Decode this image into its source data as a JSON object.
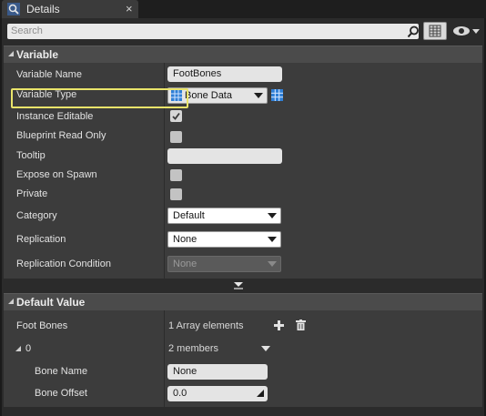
{
  "tab": {
    "label": "Details",
    "close": "×"
  },
  "search": {
    "placeholder": "Search"
  },
  "sections": {
    "variable": "Variable",
    "default_value": "Default Value"
  },
  "variable": {
    "name": {
      "label": "Variable Name",
      "value": "FootBones"
    },
    "type": {
      "label": "Variable Type",
      "value": "Bone Data"
    },
    "instance_editable": {
      "label": "Instance Editable",
      "checked": true
    },
    "blueprint_read_only": {
      "label": "Blueprint Read Only",
      "checked": false
    },
    "tooltip": {
      "label": "Tooltip",
      "value": ""
    },
    "expose_on_spawn": {
      "label": "Expose on Spawn",
      "checked": false
    },
    "private": {
      "label": "Private",
      "checked": false
    },
    "category": {
      "label": "Category",
      "value": "Default"
    },
    "replication": {
      "label": "Replication",
      "value": "None"
    },
    "replication_condition": {
      "label": "Replication Condition",
      "value": "None"
    }
  },
  "default_value": {
    "foot_bones": {
      "label": "Foot Bones",
      "value": "1 Array elements"
    },
    "element0": {
      "label": "0",
      "value": "2 members"
    },
    "bone_name": {
      "label": "Bone Name",
      "value": "None"
    },
    "bone_offset": {
      "label": "Bone Offset",
      "value": "0.0"
    }
  },
  "colors": {
    "highlight": "#e9e46a",
    "type_icon": "#2f7fd6"
  },
  "icons": [
    "details-tab-icon",
    "close-icon",
    "search-icon",
    "grid-view-icon",
    "eye-icon",
    "chevron-down-icon",
    "add-icon",
    "trash-icon",
    "expand-arrow-icon"
  ]
}
